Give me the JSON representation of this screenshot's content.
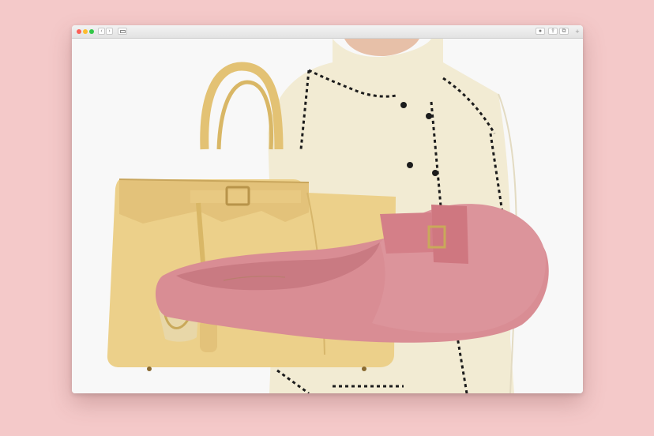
{
  "window": {
    "toolbar": {
      "back_glyph": "‹",
      "forward_glyph": "›",
      "share_glyph": "⇪",
      "tabs_glyph": "⧉",
      "download_glyph": "●",
      "new_tab_glyph": "+"
    }
  },
  "icons": [
    "close-icon",
    "minimize-icon",
    "zoom-icon",
    "chevron-left-icon",
    "chevron-right-icon",
    "sidebar-icon",
    "download-icon",
    "share-icon",
    "tabs-icon",
    "plus-icon"
  ],
  "colors": {
    "background": "#f4c9c9",
    "bag": "#ecd08a",
    "slipper": "#d98d94",
    "jacket": "#f2ebd3",
    "trim": "#1c1c1c"
  }
}
